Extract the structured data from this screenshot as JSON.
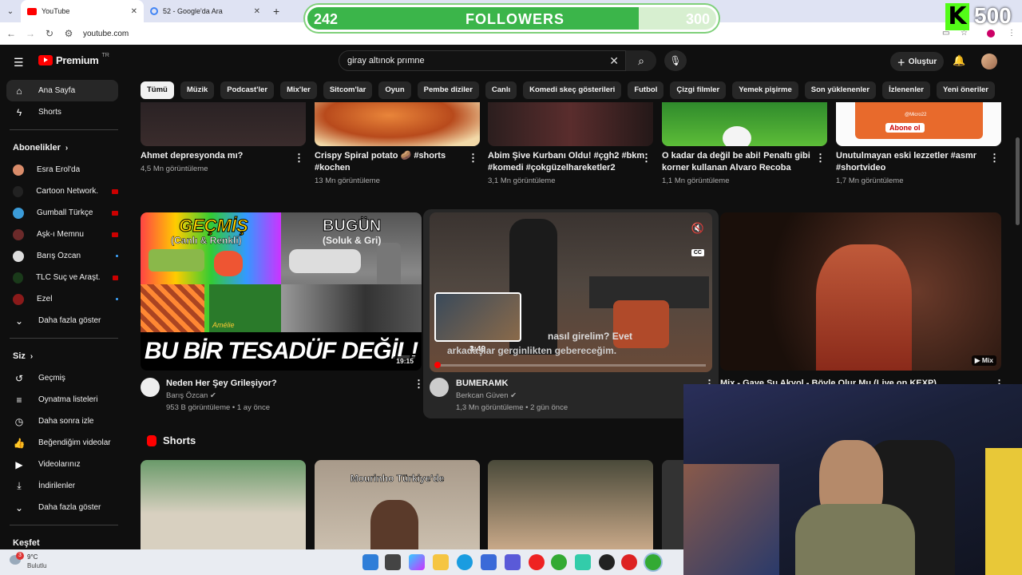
{
  "browser": {
    "tabs": [
      {
        "title": "YouTube"
      },
      {
        "title": "52 - Google'da Ara"
      }
    ],
    "url": "youtube.com"
  },
  "overlay": {
    "followers_current": "242",
    "followers_label": "FOLLOWERS",
    "followers_goal": "300",
    "followers_progress": 0.81,
    "kick_letter": "K",
    "kick_count": "500"
  },
  "masthead": {
    "logo_text": "Premium",
    "logo_region": "TR",
    "search_value": "giray altınok prımne",
    "create_label": "Oluştur"
  },
  "sidebar": {
    "main": [
      {
        "label": "Ana Sayfa",
        "icon": "home-icon"
      },
      {
        "label": "Shorts",
        "icon": "shorts-icon"
      }
    ],
    "subs_heading": "Abonelikler",
    "subs": [
      {
        "label": "Esra Erol'da",
        "color": "#d98c6a",
        "marker": "none"
      },
      {
        "label": "Cartoon Network...",
        "color": "#222222",
        "marker": "live"
      },
      {
        "label": "Gumball Türkçe",
        "color": "#3b9bd8",
        "marker": "live"
      },
      {
        "label": "Aşk-ı Memnu",
        "color": "#6b2a2a",
        "marker": "live"
      },
      {
        "label": "Barış Özcan",
        "color": "#dddddd",
        "marker": "new"
      },
      {
        "label": "TLC Suç ve Araşt...",
        "color": "#1a3a1a",
        "marker": "live"
      },
      {
        "label": "Ezel",
        "color": "#8a1a1a",
        "marker": "new"
      }
    ],
    "subs_more": "Daha fazla göster",
    "you_heading": "Siz",
    "you": [
      {
        "label": "Geçmiş",
        "icon": "history-icon"
      },
      {
        "label": "Oynatma listeleri",
        "icon": "playlist-icon"
      },
      {
        "label": "Daha sonra izle",
        "icon": "clock-icon"
      },
      {
        "label": "Beğendiğim videolar",
        "icon": "like-icon"
      },
      {
        "label": "Videolarınız",
        "icon": "video-icon"
      },
      {
        "label": "İndirilenler",
        "icon": "download-icon"
      }
    ],
    "you_more": "Daha fazla göster",
    "explore_heading": "Keşfet"
  },
  "chips": [
    "Tümü",
    "Müzik",
    "Podcast'ler",
    "Mix'ler",
    "Sitcom'lar",
    "Oyun",
    "Pembe diziler",
    "Canlı",
    "Komedi skeç gösterileri",
    "Futbol",
    "Çizgi filmler",
    "Yemek pişirme",
    "Son yüklenenler",
    "İzlenenler",
    "Yeni öneriler"
  ],
  "row1": [
    {
      "title1": "Ahmet depresyonda mı?",
      "title2": "",
      "meta": "4,5 Mn görüntüleme"
    },
    {
      "title1": "Crispy Spiral potato 🥔 #shorts",
      "title2": "#kochen",
      "meta": "13 Mn görüntüleme"
    },
    {
      "title1": "Abim Şive Kurbanı Oldu! #çgh2 #bkm",
      "title2": "#komedi #çokgüzelhareketler2",
      "meta": "3,1 Mn görüntüleme"
    },
    {
      "title1": "O kadar da değil be abi! Penaltı gibi",
      "title2": "korner kullanan Alvaro Recoba",
      "meta": "1,1 Mn görüntüleme"
    },
    {
      "title1": "Unutulmayan eski lezzetler #asmr",
      "title2": "#shortvideo",
      "meta": "1,7 Mn görüntüleme"
    }
  ],
  "row1_thumb_text": {
    "subscribe": "Abone ol",
    "handle": "@Micro22"
  },
  "row2": [
    {
      "title": "Neden Her Şey Grileşiyor?",
      "channel": "Barış Özcan",
      "meta": "953 B görüntüleme • 1 ay önce",
      "duration": "19:15",
      "thumb": {
        "past": "GEÇMİŞ",
        "past_sub": "(Canlı & Renkli)",
        "now": "BUGÜN",
        "now_sub": "(Soluk & Gri)",
        "caption": "BU BİR TESADÜF DEĞİL!",
        "amelie": "Amélie"
      }
    },
    {
      "title": "BUMERAMK",
      "channel": "Berkcan Güven",
      "meta": "1,3 Mn görüntüleme • 2 gün önce",
      "preview_time": "3:49",
      "subtitle_line1": "nasıl girelim? Evet",
      "subtitle_line2": "arkadaşlar gerginlikten gebereceğim.",
      "cc": "CC",
      "progress": 0.01
    },
    {
      "title": "Mix - Gaye Su Akyol - Böyle Olur Mu (Live on KEXP)",
      "badge": "Mix"
    }
  ],
  "shorts": {
    "heading": "Shorts",
    "first_overlay": "Mourinho Türkiye'de"
  },
  "taskbar": {
    "temp": "9°C",
    "weather": "Bulutlu",
    "badge": "3"
  }
}
